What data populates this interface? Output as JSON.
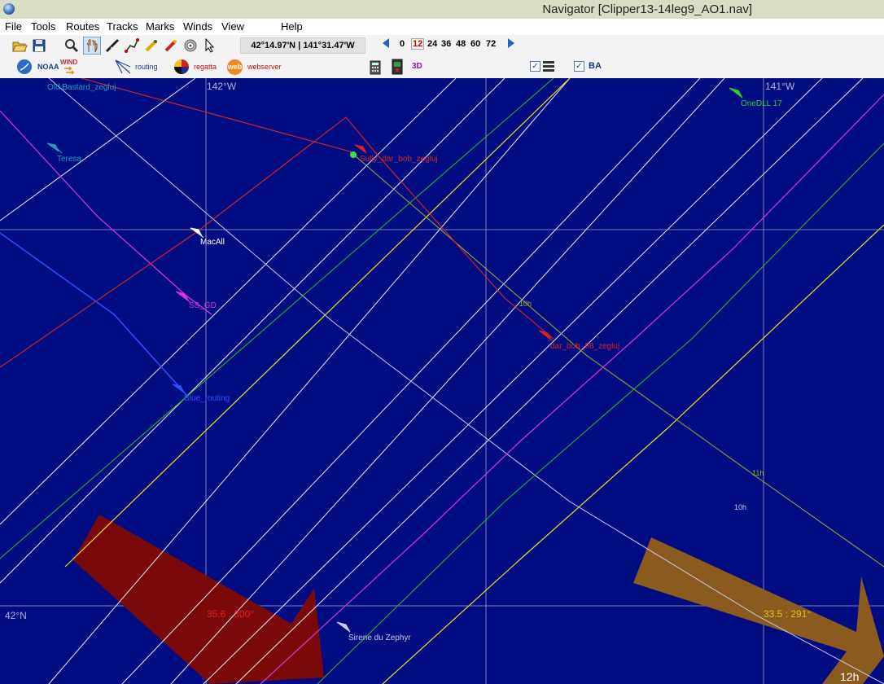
{
  "window": {
    "title": "Navigator [Clipper13-14leg9_AO1.nav]"
  },
  "menu": [
    "File",
    "Tools",
    "Routes",
    "Tracks",
    "Marks",
    "Winds",
    "View",
    "Help"
  ],
  "toolbar": {
    "coordinates": "42°14.97'N | 141°31.47'W",
    "hours": [
      "0",
      "12",
      "24",
      "36",
      "48",
      "60",
      "72"
    ],
    "selected_hour": "12"
  },
  "toolbar2": {
    "noaa": "NOAA",
    "wind": "WIND",
    "routing": "routing",
    "regatta": "regatta",
    "webserver": "webserver",
    "web_badge": "web",
    "three_d": "3D",
    "ba": "BA"
  },
  "map": {
    "lon_labels": [
      "142°W",
      "141°W"
    ],
    "lat_label": "42°N",
    "time_label": "12h",
    "wind_left": "35.6 : 300°",
    "wind_right": "33.5 : 291°",
    "boats": {
      "old_bastard": "Old Bastard_zegluj",
      "teresa": "Teresa",
      "macall": "MacAll",
      "ss_gd": "SS_GD",
      "blue": "Blue_routing",
      "bob1": "Sully_dar_bob_zegluj",
      "bob2": "dar_bob_98_zegluj",
      "onedll": "OneDLL 17",
      "sirene": "Sirene du Zephyr"
    },
    "track_marks": [
      "10h",
      "11h",
      "10h"
    ]
  },
  "colors": {
    "sea": "#000c80",
    "wind_left": "#7a0a0a",
    "wind_right": "#8a5a1e"
  }
}
